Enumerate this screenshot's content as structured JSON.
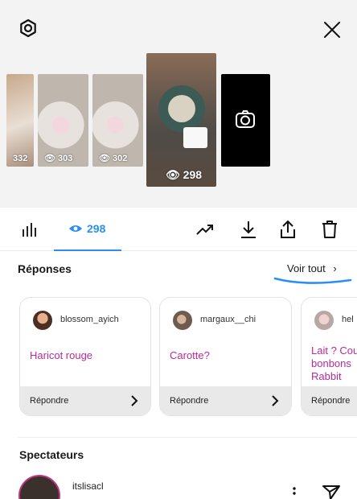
{
  "top_bar": {
    "settings_icon": "gear-icon",
    "close_icon": "close-icon"
  },
  "stories": [
    {
      "views": "332"
    },
    {
      "views": "303"
    },
    {
      "views": "302"
    },
    {
      "views": "298",
      "selected": true
    },
    {
      "type": "camera",
      "icon": "camera-icon"
    }
  ],
  "tabs": {
    "stats_icon": "bar-chart-icon",
    "viewers_count": "298",
    "viewers_icon": "eye-icon"
  },
  "actions": [
    "trend-icon",
    "download-icon",
    "share-icon",
    "trash-icon"
  ],
  "replies": {
    "title": "Réponses",
    "see_all": "Voir tout",
    "cards": [
      {
        "username": "blossom_ayich",
        "message": "Haricot rouge",
        "reply_label": "Répondre"
      },
      {
        "username": "margaux__chi",
        "message": "Carotte?",
        "reply_label": "Répondre"
      },
      {
        "username": "hel",
        "message_lines": [
          "Lait ? Cou",
          "bonbons",
          "Rabbit"
        ],
        "reply_label": "Répondre"
      }
    ]
  },
  "viewers": {
    "title": "Spectateurs",
    "list": [
      {
        "username": "itslisacl"
      }
    ]
  },
  "colors": {
    "accent_blue": "#2a8ef5",
    "reply_text": "#b62b9a",
    "underline": "#2a8ef5"
  }
}
